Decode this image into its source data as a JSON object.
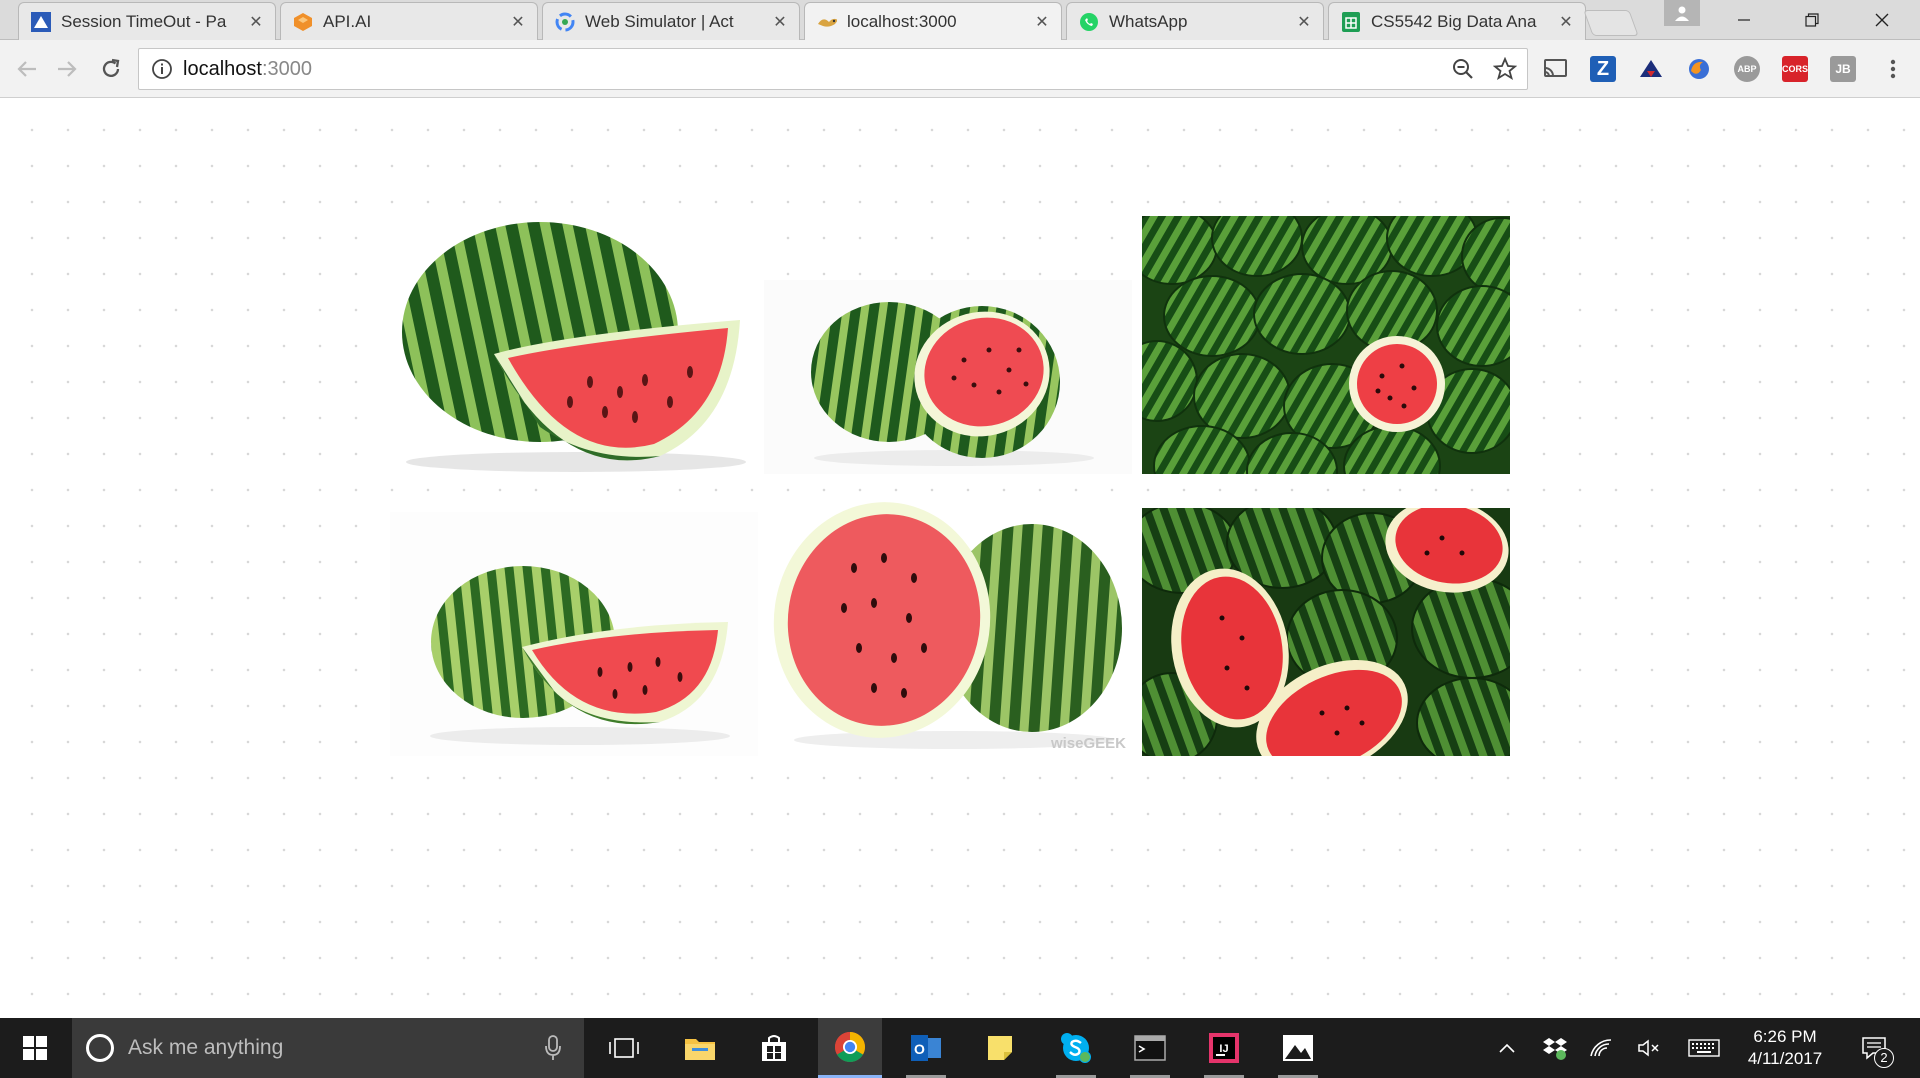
{
  "browser": {
    "tabs": [
      {
        "title": "Session TimeOut - Pa",
        "favicon": "session-favicon",
        "active": false
      },
      {
        "title": "API.AI",
        "favicon": "apiai-favicon",
        "active": false
      },
      {
        "title": "Web Simulator  |  Act",
        "favicon": "web-simulator-favicon",
        "active": false
      },
      {
        "title": "localhost:3000",
        "favicon": "localhost-favicon",
        "active": true
      },
      {
        "title": "WhatsApp",
        "favicon": "whatsapp-favicon",
        "active": false
      },
      {
        "title": "CS5542 Big Data Ana",
        "favicon": "sheets-favicon",
        "active": false
      }
    ],
    "close_glyph": "✕",
    "address": {
      "host": "localhost",
      "port": ":3000"
    },
    "extensions": [
      "cast-icon",
      "Z",
      "shield-ext-icon",
      "firefox-ext-icon",
      "ABP",
      "CORS",
      "JB",
      "menu-icon"
    ]
  },
  "page": {
    "images": [
      {
        "subject": "watermelon whole with wedge"
      },
      {
        "subject": "watermelon with half"
      },
      {
        "subject": "watermelon pile"
      },
      {
        "subject": "watermelon whole with slice"
      },
      {
        "subject": "watermelon halves",
        "watermark": "wiseGEEK"
      },
      {
        "subject": "watermelons cut at market"
      }
    ]
  },
  "taskbar": {
    "search_placeholder": "Ask me anything",
    "time": "6:26 PM",
    "date": "4/11/2017",
    "notification_count": "2"
  },
  "colors": {
    "watermelon_rind_dark": "#1f5a1c",
    "watermelon_rind_light": "#8dc15a",
    "watermelon_flesh": "#f04a4f",
    "taskbar": "#1c1c1c"
  }
}
